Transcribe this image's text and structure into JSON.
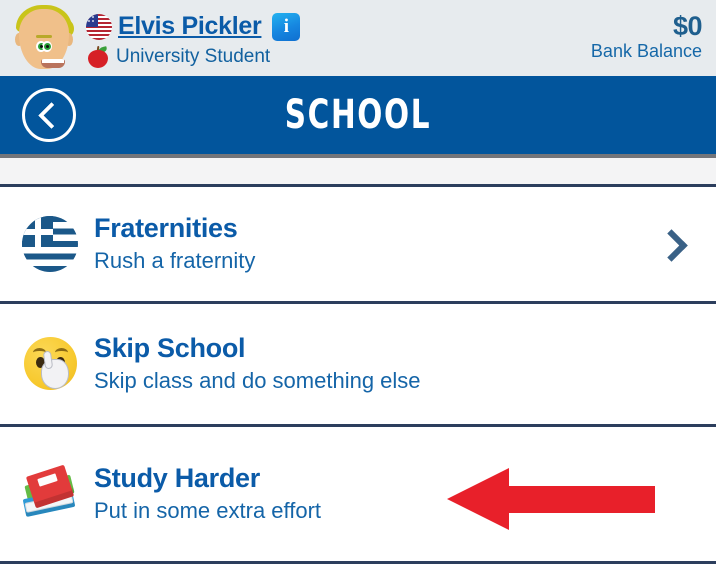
{
  "header": {
    "avatar_icon": "blond-person-emoji",
    "flag_icon": "us-flag-emoji",
    "player_name": "Elvis Pickler",
    "info_icon": "information-badge-icon",
    "status_icon": "red-apple-emoji",
    "status_text": "University Student",
    "balance_amount": "$0",
    "balance_label": "Bank Balance",
    "background_color": "#e7ebee"
  },
  "banner": {
    "back_icon": "chevron-left-icon",
    "title": "SCHOOL",
    "background_color": "#02559c",
    "underline_color": "#73757a"
  },
  "list": {
    "items": [
      {
        "icon": "greek-flag-emoji",
        "title": "Fraternities",
        "subtitle": "Rush a fraternity",
        "chevron_icon": "chevron-right-icon",
        "has_chevron": true
      },
      {
        "icon": "shushing-face-emoji",
        "title": "Skip School",
        "subtitle": "Skip class and do something else",
        "chevron_icon": "chevron-right-icon",
        "has_chevron": false
      },
      {
        "icon": "stack-of-books-emoji",
        "title": "Study Harder",
        "subtitle": "Put in some extra effort",
        "chevron_icon": "chevron-right-icon",
        "has_chevron": false
      }
    ],
    "title_color": "#0b5ba8",
    "subtitle_color": "#1565a8",
    "separator_color": "#2c3e5d"
  },
  "annotation": {
    "arrow_icon": "red-arrow-left-icon",
    "color": "#e8202a",
    "points_to": "Study Harder"
  }
}
